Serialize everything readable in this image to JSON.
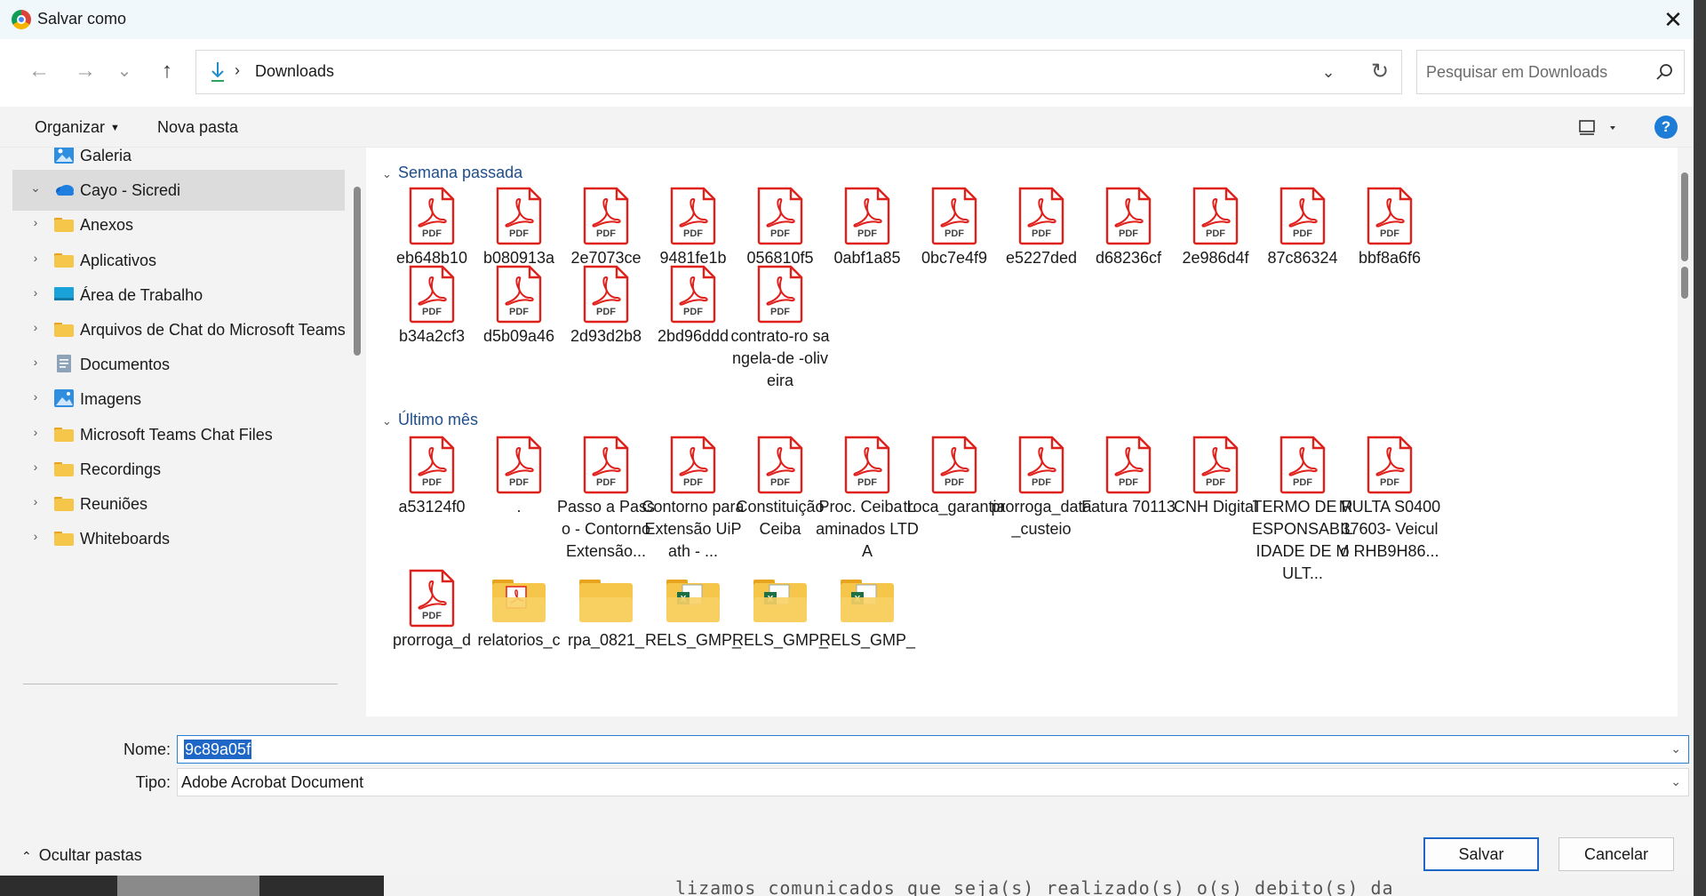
{
  "window": {
    "title": "Salvar como",
    "close_label": "✕"
  },
  "address": {
    "nav_back": "←",
    "nav_forward": "→",
    "nav_recent": "⌄",
    "nav_up": "↑",
    "separator": "›",
    "path": "Downloads",
    "refresh": "↻",
    "dropdown": "⌄"
  },
  "search": {
    "placeholder": "Pesquisar em Downloads"
  },
  "toolbar": {
    "organize_label": "Organizar",
    "new_folder_label": "Nova pasta",
    "help_label": "?"
  },
  "sidebar": {
    "items": [
      {
        "label": "Galeria",
        "icon": "gallery-icon",
        "chevron": ""
      },
      {
        "label": "Cayo - Sicredi",
        "icon": "onedrive-icon",
        "chevron": "⌄",
        "selected": true
      },
      {
        "label": "Anexos",
        "icon": "folder-icon",
        "chevron": "›"
      },
      {
        "label": "Aplicativos",
        "icon": "folder-icon",
        "chevron": "›"
      },
      {
        "label": "Área de Trabalho",
        "icon": "desktop-icon",
        "chevron": "›"
      },
      {
        "label": "Arquivos de Chat do Microsoft Teams",
        "icon": "folder-icon",
        "chevron": "›"
      },
      {
        "label": "Documentos",
        "icon": "document-icon",
        "chevron": "›"
      },
      {
        "label": "Imagens",
        "icon": "pictures-icon",
        "chevron": "›"
      },
      {
        "label": "Microsoft Teams Chat Files",
        "icon": "folder-icon",
        "chevron": "›"
      },
      {
        "label": "Recordings",
        "icon": "folder-icon",
        "chevron": "›"
      },
      {
        "label": "Reuniões",
        "icon": "folder-icon",
        "chevron": "›"
      },
      {
        "label": "Whiteboards",
        "icon": "folder-icon",
        "chevron": "›"
      }
    ]
  },
  "content": {
    "groups": [
      {
        "title": "Semana passada",
        "chevron": "⌄",
        "files": [
          {
            "name": "eb648b10",
            "type": "pdf"
          },
          {
            "name": "b080913a",
            "type": "pdf"
          },
          {
            "name": "2e7073ce",
            "type": "pdf"
          },
          {
            "name": "9481fe1b",
            "type": "pdf"
          },
          {
            "name": "056810f5",
            "type": "pdf"
          },
          {
            "name": "0abf1a85",
            "type": "pdf"
          },
          {
            "name": "0bc7e4f9",
            "type": "pdf"
          },
          {
            "name": "e5227ded",
            "type": "pdf"
          },
          {
            "name": "d68236cf",
            "type": "pdf"
          },
          {
            "name": "2e986d4f",
            "type": "pdf"
          },
          {
            "name": "87c86324",
            "type": "pdf"
          },
          {
            "name": "bbf8a6f6",
            "type": "pdf"
          },
          {
            "name": "b34a2cf3",
            "type": "pdf"
          },
          {
            "name": "d5b09a46",
            "type": "pdf"
          },
          {
            "name": "2d93d2b8",
            "type": "pdf"
          },
          {
            "name": "2bd96ddd",
            "type": "pdf"
          },
          {
            "name": "contrato-ro sangela-de -oliveira",
            "type": "pdf"
          }
        ]
      },
      {
        "title": "Último mês",
        "chevron": "⌄",
        "files": [
          {
            "name": "a53124f0",
            "type": "pdf"
          },
          {
            "name": ".",
            "type": "pdf"
          },
          {
            "name": "Passo a Passo - Contorno Extensão...",
            "type": "pdf"
          },
          {
            "name": "Contorno para Extensão UiPath - ...",
            "type": "pdf"
          },
          {
            "name": "Constituição Ceiba",
            "type": "pdf"
          },
          {
            "name": "Proc. Ceiba Laminados LTDA",
            "type": "pdf"
          },
          {
            "name": "troca_garantia",
            "type": "pdf"
          },
          {
            "name": "prorroga_data_custeio",
            "type": "pdf"
          },
          {
            "name": "Fatura 70113",
            "type": "pdf"
          },
          {
            "name": "CNH Digital",
            "type": "pdf"
          },
          {
            "name": "TERMO DE RESPONSABILIDADE DE MULT...",
            "type": "pdf"
          },
          {
            "name": "MULTA S040037603- Veiculo RHB9H86...",
            "type": "pdf"
          },
          {
            "name": "prorroga_d",
            "type": "pdf"
          },
          {
            "name": "relatorios_c",
            "type": "folder-pdf"
          },
          {
            "name": "rpa_0821_",
            "type": "folder"
          },
          {
            "name": "RELS_GMP_",
            "type": "folder-xls"
          },
          {
            "name": "RELS_GMP_",
            "type": "folder-xls"
          },
          {
            "name": "RELS_GMP_",
            "type": "folder-xls"
          }
        ]
      }
    ],
    "pdf_badge": "PDF"
  },
  "form": {
    "name_label": "Nome:",
    "name_value": "9c89a05f",
    "type_label": "Tipo:",
    "type_value": "Adobe Acrobat Document",
    "dropdown": "⌄"
  },
  "footer": {
    "hide_folders_label": "Ocultar pastas",
    "hide_chevron": "⌃",
    "save_label": "Salvar",
    "cancel_label": "Cancelar"
  },
  "background": {
    "terminal_text": "lizamos  comunicados  que  seja(s)  realizado(s)  o(s)  debito(s) da"
  },
  "colors": {
    "accent": "#1f67c6",
    "pdf_red": "#e0201b",
    "folder_yellow": "#f6c64a",
    "group_header": "#1e4e8c"
  }
}
